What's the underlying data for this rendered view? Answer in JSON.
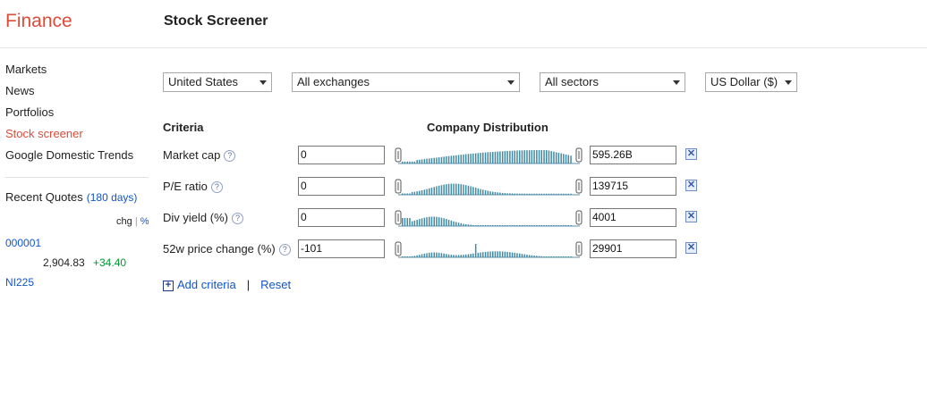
{
  "header": {
    "brand": "Finance",
    "title": "Stock Screener"
  },
  "sidebar": {
    "items": [
      {
        "label": "Markets",
        "active": false
      },
      {
        "label": "News",
        "active": false
      },
      {
        "label": "Portfolios",
        "active": false
      },
      {
        "label": "Stock screener",
        "active": true
      },
      {
        "label": "Google Domestic Trends",
        "active": false
      }
    ],
    "recent_quotes": {
      "title": "Recent Quotes",
      "days": "(180 days)",
      "chg_label": "chg",
      "separator": "|",
      "pct_label": "%",
      "quotes": [
        {
          "symbol": "000001",
          "price": "2,904.83",
          "change": "+34.40"
        },
        {
          "symbol": "NI225"
        }
      ]
    }
  },
  "filters": {
    "region": "United States",
    "exchange": "All exchanges",
    "sector": "All sectors",
    "currency": "US Dollar ($)"
  },
  "table": {
    "criteria_header": "Criteria",
    "distribution_header": "Company Distribution",
    "help_glyph": "?",
    "remove_glyph": "✕",
    "rows": [
      {
        "label": "Market cap",
        "min": "0",
        "max": "595.26B"
      },
      {
        "label": "P/E ratio",
        "min": "0",
        "max": "139715"
      },
      {
        "label": "Div yield (%)",
        "min": "0",
        "max": "4001"
      },
      {
        "label": "52w price change (%)",
        "min": "-101",
        "max": "29901"
      }
    ]
  },
  "actions": {
    "plus_glyph": "+",
    "add_criteria": "Add criteria",
    "separator": "|",
    "reset": "Reset"
  },
  "colors": {
    "brand": "#dd4b39",
    "link": "#1155cc",
    "positive": "#009933",
    "histogram": "#3f8aa6"
  }
}
